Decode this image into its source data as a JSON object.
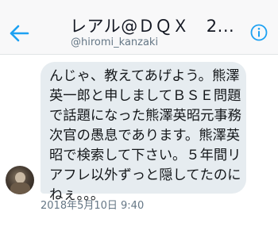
{
  "header": {
    "title": "レアル@ＤＱＸ　2...",
    "handle": "@hiromi_kanzaki",
    "back_icon": "back-arrow-icon",
    "info_icon": "info-icon",
    "accent_color": "#1da1f2"
  },
  "message": {
    "lines": [
      "んじゃ、教えてあげよう。熊澤",
      "英一郎と申しましてＢＳＥ問題",
      "で話題になった熊澤英昭元事務",
      "次官の愚息であります。熊澤英",
      "昭で検索して下さい。５年間リ",
      "アフレ以外ずっと隠してたのに",
      "ねぇ。。。"
    ],
    "timestamp": "2018年5月10日 9:40"
  }
}
